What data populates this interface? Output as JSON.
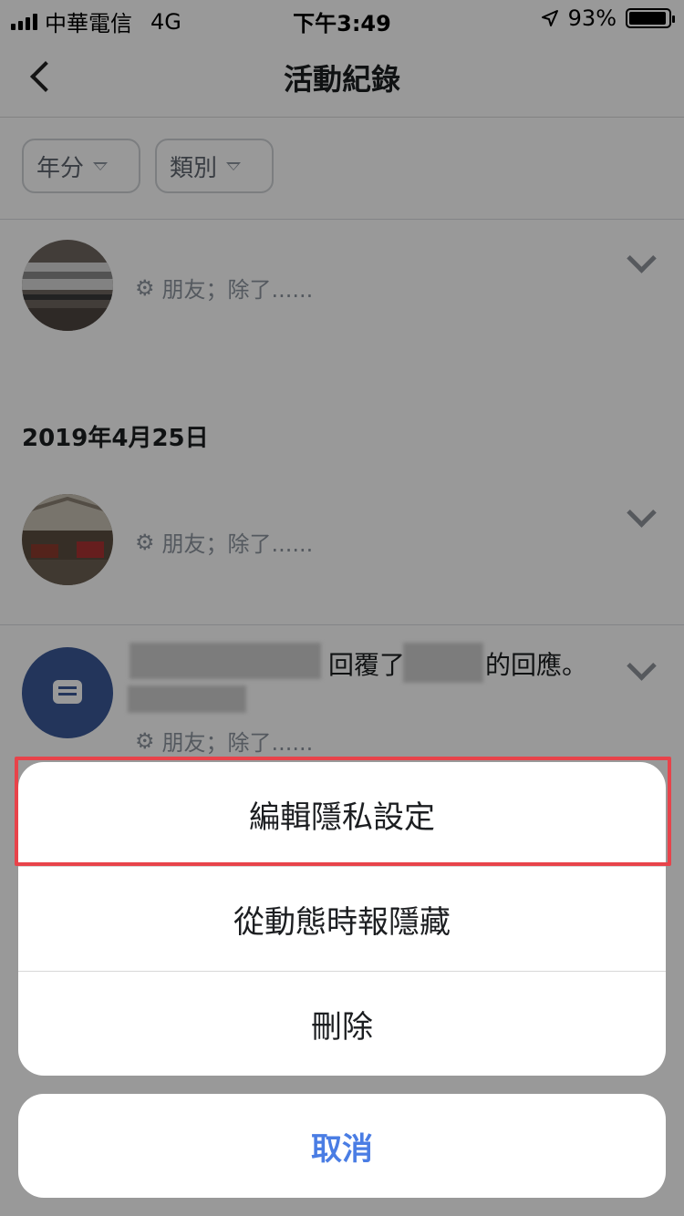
{
  "status_bar": {
    "carrier": "中華電信",
    "network": "4G",
    "time": "下午3:49",
    "battery": "93%"
  },
  "nav": {
    "title": "活動紀錄"
  },
  "filters": {
    "year_label": "年分",
    "category_label": "類別"
  },
  "feed": {
    "entry1": {
      "privacy": "朋友；除了......"
    },
    "date_header": "2019年4月25日",
    "entry2": {
      "privacy": "朋友；除了......"
    },
    "entry3": {
      "text_part1": "回覆了",
      "text_part2": "的回應。",
      "privacy": "朋友；除了......"
    }
  },
  "action_sheet": {
    "items": [
      {
        "label": "編輯隱私設定"
      },
      {
        "label": "從動態時報隱藏"
      },
      {
        "label": "刪除"
      }
    ],
    "cancel_label": "取消"
  },
  "colors": {
    "accent": "#4a7de4",
    "highlight_border": "#e8434a",
    "comment_icon_bg": "#3b5998"
  }
}
